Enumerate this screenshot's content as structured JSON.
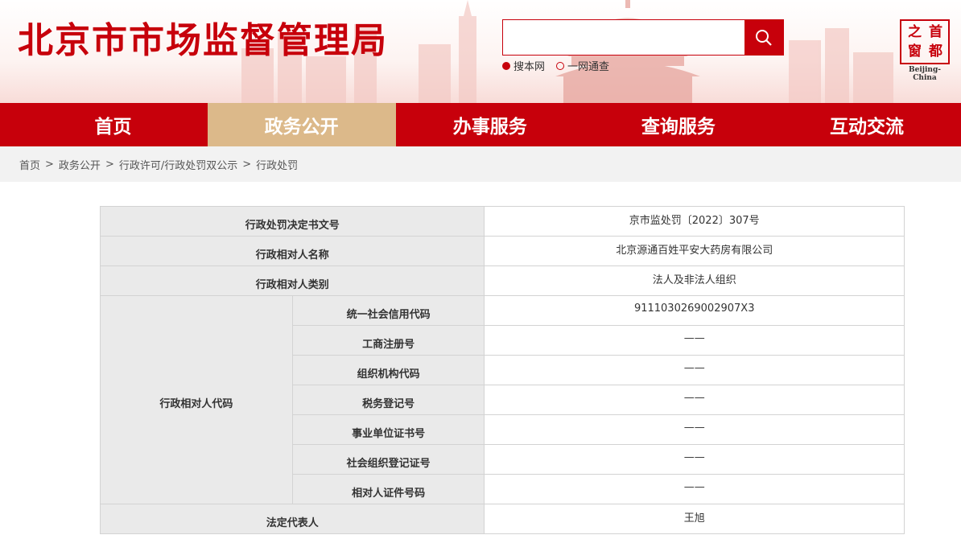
{
  "header": {
    "site_title": "北京市市场监督管理局",
    "search": {
      "placeholder": "",
      "options": [
        {
          "label": "搜本网",
          "selected": true
        },
        {
          "label": "一网通查",
          "selected": false
        }
      ]
    },
    "logo": {
      "chars": [
        "首",
        "都",
        "之",
        "窗"
      ],
      "subtitle": "Beijing-China"
    }
  },
  "nav": {
    "items": [
      {
        "label": "首页",
        "active": false
      },
      {
        "label": "政务公开",
        "active": true
      },
      {
        "label": "办事服务",
        "active": false
      },
      {
        "label": "查询服务",
        "active": false
      },
      {
        "label": "互动交流",
        "active": false
      }
    ]
  },
  "breadcrumb": [
    "首页",
    "政务公开",
    "行政许可/行政处罚双公示",
    "行政处罚"
  ],
  "breadcrumb_sep": ">",
  "detail": {
    "decision_no": {
      "label": "行政处罚决定书文号",
      "value": "京市监处罚〔2022〕307号"
    },
    "party_name": {
      "label": "行政相对人名称",
      "value": "北京源通百姓平安大药房有限公司"
    },
    "party_type": {
      "label": "行政相对人类别",
      "value": "法人及非法人组织"
    },
    "party_code": {
      "label": "行政相对人代码",
      "rows": [
        {
          "label": "统一社会信用代码",
          "value": "9111030269002907X3"
        },
        {
          "label": "工商注册号",
          "value": "——"
        },
        {
          "label": "组织机构代码",
          "value": "——"
        },
        {
          "label": "税务登记号",
          "value": "——"
        },
        {
          "label": "事业单位证书号",
          "value": "——"
        },
        {
          "label": "社会组织登记证号",
          "value": "——"
        },
        {
          "label": "相对人证件号码",
          "value": "——"
        }
      ]
    },
    "legal_rep": {
      "label": "法定代表人",
      "value": "王旭"
    }
  },
  "colors": {
    "brand_red": "#c7000b",
    "nav_active": "#dcb98a"
  }
}
